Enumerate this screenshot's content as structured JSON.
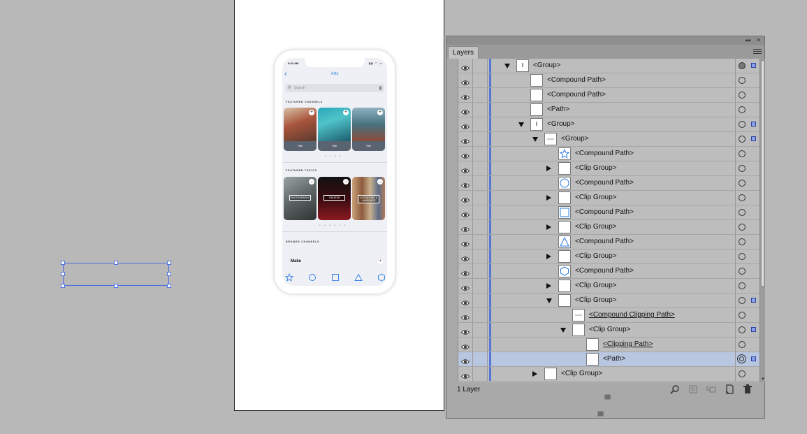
{
  "canvas": {
    "artboard_bg": "#ffffff",
    "pasteboard_bg": "#b8b8b8",
    "selection_color": "#4a6fe0"
  },
  "phone": {
    "status_time": "9:41 AM",
    "status_icons": "▮▮ ◠ ▭",
    "title": "Arts",
    "search_placeholder": "Search",
    "featured_channels_label": "FEATURED CHANNELS",
    "channels": [
      {
        "caption": "Title"
      },
      {
        "caption": "Title"
      },
      {
        "caption": "Title"
      }
    ],
    "featured_topics_label": "FEATURED TOPICS",
    "topics": [
      {
        "label": "PHOTOGRAPHY"
      },
      {
        "label": "THEATER"
      },
      {
        "label": "LITERATURE & LANGUAGE"
      }
    ],
    "channel_dots": "• • • •",
    "topic_dots": "• • • • • •",
    "browse_label": "BROWSE CHANNELS",
    "browse_item": "Make",
    "add_glyph": "+",
    "arrow_glyph": "→",
    "back_glyph": "‹",
    "accent": "#2b7be0"
  },
  "panel": {
    "collapse_glyph": "◂◂",
    "close_glyph": "✕",
    "tab_label": "Layers",
    "footer_count": "1 Layer",
    "rows": [
      {
        "name": "<Group>",
        "indent": 0,
        "toggle": "down",
        "target": "filled",
        "selected_square": true,
        "thumb": "group"
      },
      {
        "name": "<Compound Path>",
        "indent": 1,
        "toggle": "",
        "target": "hollow",
        "selected_square": false,
        "thumb": "blank"
      },
      {
        "name": "<Compound Path>",
        "indent": 1,
        "toggle": "",
        "target": "hollow",
        "selected_square": false,
        "thumb": "blank"
      },
      {
        "name": "<Path>",
        "indent": 1,
        "toggle": "",
        "target": "hollow",
        "selected_square": false,
        "thumb": "blank"
      },
      {
        "name": "<Group>",
        "indent": 1,
        "toggle": "down",
        "target": "hollow",
        "selected_square": true,
        "thumb": "group"
      },
      {
        "name": "<Group>",
        "indent": 2,
        "toggle": "down",
        "target": "hollow",
        "selected_square": true,
        "thumb": "line"
      },
      {
        "name": "<Compound Path>",
        "indent": 3,
        "toggle": "",
        "target": "hollow",
        "selected_square": false,
        "thumb": "star"
      },
      {
        "name": "<Clip Group>",
        "indent": 3,
        "toggle": "right",
        "target": "hollow",
        "selected_square": false,
        "thumb": "blank"
      },
      {
        "name": "<Compound Path>",
        "indent": 3,
        "toggle": "",
        "target": "hollow",
        "selected_square": false,
        "thumb": "circle"
      },
      {
        "name": "<Clip Group>",
        "indent": 3,
        "toggle": "right",
        "target": "hollow",
        "selected_square": false,
        "thumb": "blank"
      },
      {
        "name": "<Compound Path>",
        "indent": 3,
        "toggle": "",
        "target": "hollow",
        "selected_square": false,
        "thumb": "square"
      },
      {
        "name": "<Clip Group>",
        "indent": 3,
        "toggle": "right",
        "target": "hollow",
        "selected_square": false,
        "thumb": "blank"
      },
      {
        "name": "<Compound Path>",
        "indent": 3,
        "toggle": "",
        "target": "hollow",
        "selected_square": false,
        "thumb": "triangle"
      },
      {
        "name": "<Clip Group>",
        "indent": 3,
        "toggle": "right",
        "target": "hollow",
        "selected_square": false,
        "thumb": "blank"
      },
      {
        "name": "<Compound Path>",
        "indent": 3,
        "toggle": "",
        "target": "hollow",
        "selected_square": false,
        "thumb": "hexagon"
      },
      {
        "name": "<Clip Group>",
        "indent": 3,
        "toggle": "right",
        "target": "hollow",
        "selected_square": false,
        "thumb": "blank"
      },
      {
        "name": "<Clip Group>",
        "indent": 3,
        "toggle": "down",
        "target": "hollow",
        "selected_square": true,
        "thumb": "blank"
      },
      {
        "name": "<Compound Clipping Path>",
        "indent": 4,
        "toggle": "",
        "target": "hollow",
        "selected_square": false,
        "thumb": "line",
        "underline": true
      },
      {
        "name": "<Clip Group>",
        "indent": 4,
        "toggle": "down",
        "target": "hollow",
        "selected_square": true,
        "thumb": "blank"
      },
      {
        "name": "<Clipping Path>",
        "indent": 5,
        "toggle": "",
        "target": "hollow",
        "selected_square": false,
        "thumb": "blank",
        "underline": true
      },
      {
        "name": "<Path>",
        "indent": 5,
        "toggle": "",
        "target": "double",
        "selected_square": true,
        "thumb": "blank",
        "selected": true
      },
      {
        "name": "<Clip Group>",
        "indent": 2,
        "toggle": "right",
        "target": "hollow",
        "selected_square": false,
        "thumb": "blank"
      }
    ],
    "footer_icons": [
      "locate-object-icon",
      "make-clipping-mask-icon",
      "create-sublayer-icon",
      "new-layer-icon",
      "delete-icon"
    ]
  }
}
